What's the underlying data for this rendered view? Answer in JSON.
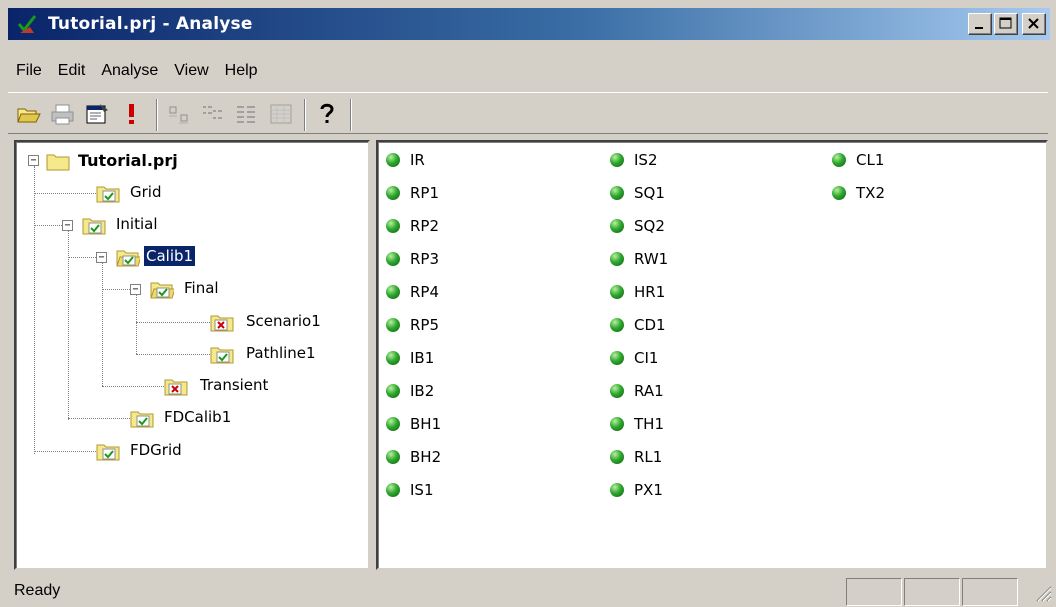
{
  "window": {
    "title": "Tutorial.prj - Analyse",
    "buttons": [
      {
        "name": "minimize",
        "icon": "minimize-icon"
      },
      {
        "name": "maximize",
        "icon": "maximize-icon"
      },
      {
        "name": "close",
        "icon": "close-icon"
      }
    ]
  },
  "menu": {
    "items": [
      "File",
      "Edit",
      "Analyse",
      "View",
      "Help"
    ]
  },
  "toolbar": {
    "buttons": [
      {
        "icon": "open-folder-icon",
        "enabled": true
      },
      {
        "icon": "print-icon",
        "enabled": false
      },
      {
        "icon": "properties-icon",
        "enabled": true
      },
      {
        "icon": "run-exclamation-icon",
        "enabled": true
      },
      {
        "icon": "large-icons-view-icon",
        "enabled": false
      },
      {
        "icon": "small-icons-view-icon",
        "enabled": false
      },
      {
        "icon": "list-view-icon",
        "enabled": false
      },
      {
        "icon": "details-view-icon",
        "enabled": false
      },
      {
        "icon": "help-question-icon",
        "enabled": true
      }
    ]
  },
  "tree": {
    "nodes": [
      {
        "label": "Tutorial.prj",
        "status": "none",
        "expanded": true,
        "selected": false
      },
      {
        "label": "Grid",
        "status": "ok",
        "selected": false
      },
      {
        "label": "Initial",
        "status": "ok",
        "expanded": true,
        "selected": false
      },
      {
        "label": "Calib1",
        "status": "ok",
        "expanded": true,
        "selected": true
      },
      {
        "label": "Final",
        "status": "ok",
        "expanded": true,
        "selected": false
      },
      {
        "label": "Scenario1",
        "status": "error",
        "selected": false
      },
      {
        "label": "Pathline1",
        "status": "ok",
        "selected": false
      },
      {
        "label": "Transient",
        "status": "error",
        "selected": false
      },
      {
        "label": "FDCalib1",
        "status": "ok",
        "selected": false
      },
      {
        "label": "FDGrid",
        "status": "ok",
        "selected": false
      }
    ]
  },
  "list": {
    "columns": [
      [
        "IR",
        "RP1",
        "RP2",
        "RP3",
        "RP4",
        "RP5",
        "IB1",
        "IB2",
        "BH1",
        "BH2",
        "IS1"
      ],
      [
        "IS2",
        "SQ1",
        "SQ2",
        "RW1",
        "HR1",
        "CD1",
        "CI1",
        "RA1",
        "TH1",
        "RL1",
        "PX1"
      ],
      [
        "CL1",
        "TX2"
      ]
    ],
    "status_color": "#2fa82f"
  },
  "status": {
    "text": "Ready"
  },
  "colors": {
    "titlebar_start": "#0a246a",
    "titlebar_end": "#a6caf0",
    "selection": "#0a246a",
    "ok_check": "#1a9a1a",
    "error_x": "#cc0000",
    "folder": "#f5e98c"
  }
}
